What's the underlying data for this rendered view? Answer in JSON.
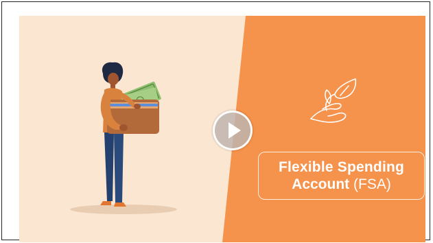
{
  "video": {
    "title_line1": "Flexible Spending",
    "title_line2_main": "Account",
    "title_line2_suffix": "(FSA)",
    "icon": "plant-in-hand-icon",
    "play_icon": "play-icon"
  },
  "colors": {
    "left_bg": "#fbe6d2",
    "right_bg": "#f5924b",
    "title_text": "#ffffff"
  }
}
